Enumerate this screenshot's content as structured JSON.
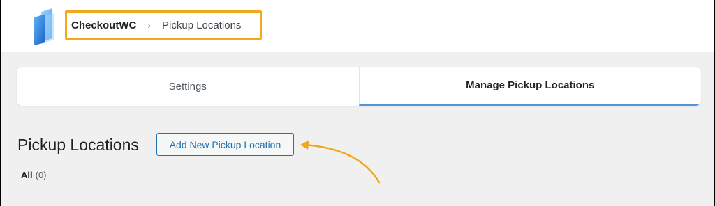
{
  "header": {
    "breadcrumb": {
      "root": "CheckoutWC",
      "separator": "›",
      "current": "Pickup Locations"
    },
    "logo_icon": "checkoutwc-logo-icon"
  },
  "tabs": [
    {
      "label": "Settings",
      "active": false
    },
    {
      "label": "Manage Pickup Locations",
      "active": true
    }
  ],
  "main": {
    "title": "Pickup Locations",
    "add_new_label": "Add New Pickup Location",
    "filters": [
      {
        "label": "All",
        "count": "(0)"
      }
    ]
  },
  "colors": {
    "highlight": "#f3a81b",
    "accent": "#2271b1",
    "tab_underline": "#4f94d4"
  }
}
